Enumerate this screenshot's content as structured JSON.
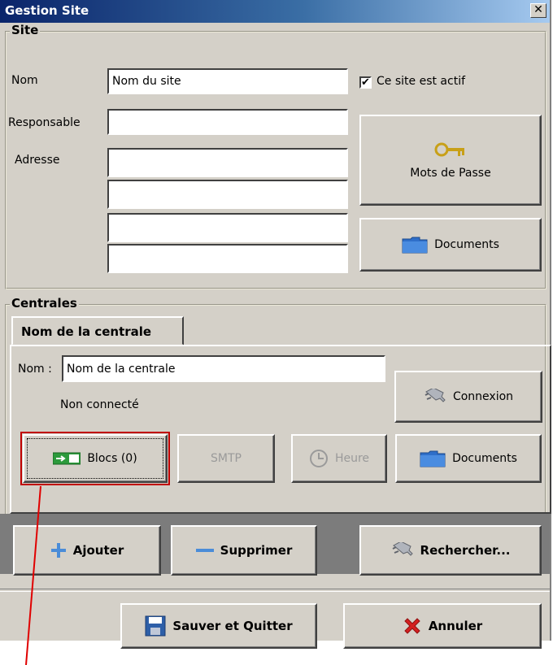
{
  "window": {
    "title": "Gestion Site",
    "close_icon": "close-icon"
  },
  "site": {
    "group_title": "Site",
    "name_label": "Nom",
    "name_value": "Nom du site",
    "active_label": "Ce site est actif",
    "active_checked": "✔",
    "manager_label": "Responsable",
    "manager_value": "",
    "address_label": "Adresse",
    "address_lines": [
      "",
      "",
      "",
      ""
    ],
    "passwords_button": "Mots de Passe",
    "documents_button": "Documents"
  },
  "centrales": {
    "group_title": "Centrales",
    "tab_label": "Nom de la centrale",
    "name_label": "Nom :",
    "name_value": "Nom de la centrale",
    "status": "Non connecté",
    "connect_button": "Connexion",
    "blocks_button": "Blocs (0)",
    "smtp_button": "SMTP",
    "time_button": "Heure",
    "documents_button": "Documents"
  },
  "actions": {
    "add": "Ajouter",
    "remove": "Supprimer",
    "search": "Rechercher..."
  },
  "footer": {
    "save_quit": "Sauver et Quitter",
    "cancel": "Annuler"
  },
  "colors": {
    "title_bar": "#0a246a",
    "window_bg": "#d4d0c8",
    "annotation": "#e00000",
    "folder": "#2f6fc9"
  }
}
